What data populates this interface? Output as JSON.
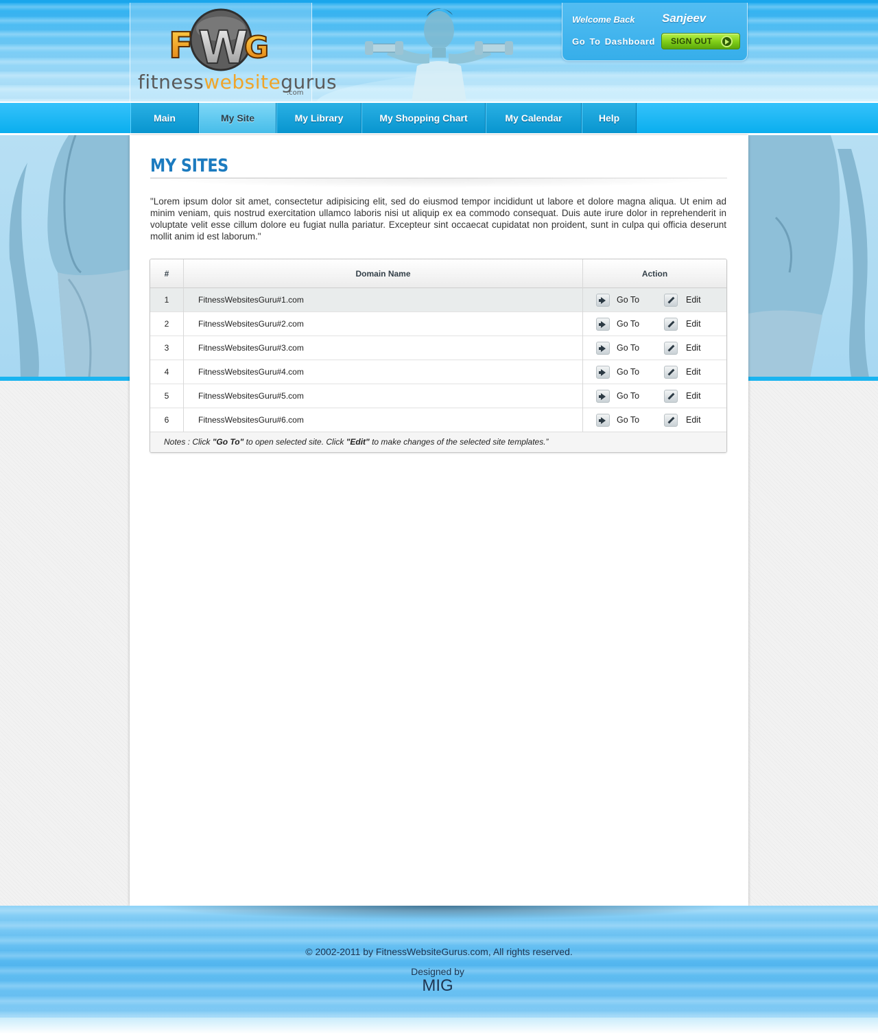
{
  "header": {
    "logo_letters": "FWG",
    "logo_text_start": "fitness",
    "logo_text_mid": "website",
    "logo_text_end": "gurus",
    "logo_dotcom": ".com",
    "welcome_label": "Welcome Back",
    "user_name": "Sanjeev",
    "dashboard_link": "Go To Dashboard",
    "signout_label": "SIGN OUT",
    "signout_icon": "play-circle-icon"
  },
  "nav": {
    "items": [
      {
        "label": "Main"
      },
      {
        "label": "My Site"
      },
      {
        "label": "My Library"
      },
      {
        "label": "My Shopping Chart"
      },
      {
        "label": "My Calendar"
      },
      {
        "label": "Help"
      }
    ],
    "active": "My Site"
  },
  "main": {
    "title": "MY SITES",
    "intro": "\"Lorem ipsum dolor sit amet, consectetur adipisicing elit, sed do eiusmod tempor incididunt ut labore et dolore magna aliqua. Ut enim ad minim veniam, quis nostrud exercitation ullamco laboris nisi ut aliquip ex ea commodo consequat. Duis aute irure dolor in reprehenderit in voluptate velit esse cillum dolore eu fugiat nulla pariatur. Excepteur sint occaecat cupidatat non proident, sunt in culpa qui officia deserunt mollit anim id est laborum.\"",
    "table": {
      "headers": {
        "num": "#",
        "domain": "Domain Name",
        "action": "Action"
      },
      "goto_label": "Go To",
      "edit_label": "Edit",
      "rows": [
        {
          "num": "1",
          "domain": "FitnessWebsitesGuru#1.com"
        },
        {
          "num": "2",
          "domain": "FitnessWebsitesGuru#2.com"
        },
        {
          "num": "3",
          "domain": "FitnessWebsitesGuru#3.com"
        },
        {
          "num": "4",
          "domain": "FitnessWebsitesGuru#4.com"
        },
        {
          "num": "5",
          "domain": "FitnessWebsitesGuru#5.com"
        },
        {
          "num": "6",
          "domain": "FitnessWebsitesGuru#6.com"
        }
      ],
      "notes": {
        "prefix": "Notes : Click ",
        "goto": "\"Go To\"",
        "middle": " to open selected site. Click ",
        "edit": "\"Edit\"",
        "suffix": " to make changes of the selected site templates.”"
      }
    }
  },
  "footer": {
    "copyright": "© 2002-2011 by FitnessWebsiteGurus.com, All rights reserved.",
    "designed_by": "Designed by",
    "designer": "MIG"
  },
  "colors": {
    "brand_blue": "#1c7bbf",
    "nav_blue": "#0aaeee",
    "signout_green": "#7fcc18",
    "logo_orange": "#f0a52a"
  }
}
